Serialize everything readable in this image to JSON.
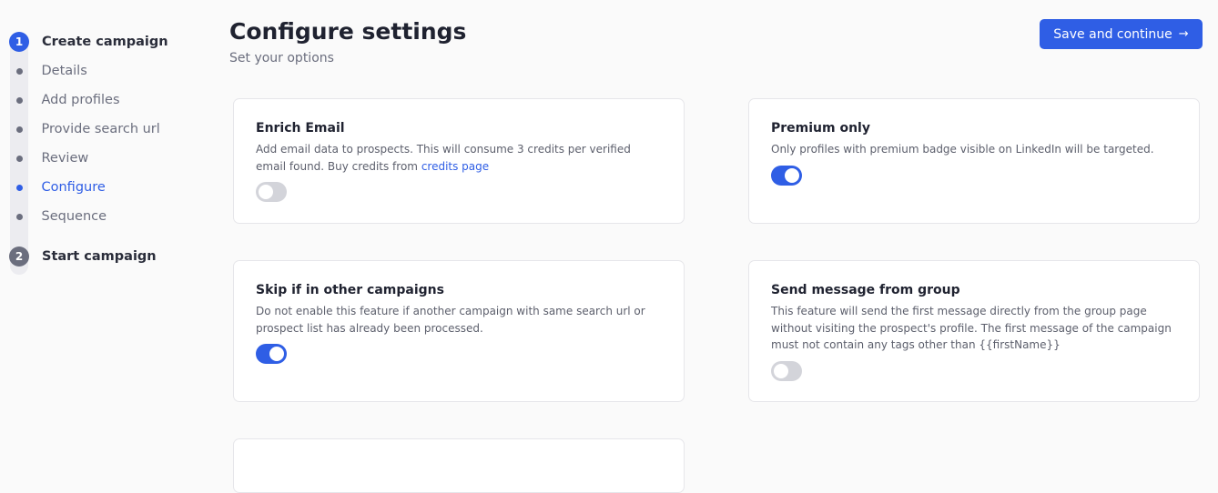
{
  "sidebar": {
    "step1": {
      "number": "1",
      "title": "Create campaign"
    },
    "items": [
      {
        "label": "Details",
        "active": false
      },
      {
        "label": "Add profiles",
        "active": false
      },
      {
        "label": "Provide search url",
        "active": false
      },
      {
        "label": "Review",
        "active": false
      },
      {
        "label": "Configure",
        "active": true
      },
      {
        "label": "Sequence",
        "active": false
      }
    ],
    "step2": {
      "number": "2",
      "title": "Start campaign"
    }
  },
  "header": {
    "title": "Configure settings",
    "subtitle": "Set your options",
    "save_label": "Save and continue",
    "save_arrow": "→"
  },
  "cards": {
    "enrich_email": {
      "title": "Enrich Email",
      "desc": "Add email data to prospects. This will consume 3 credits per verified email found. Buy credits from",
      "link": "credits page",
      "enabled": false
    },
    "premium_only": {
      "title": "Premium only",
      "desc": "Only profiles with premium badge visible on LinkedIn will be targeted.",
      "enabled": true
    },
    "skip_other": {
      "title": "Skip if in other campaigns",
      "desc": "Do not enable this feature if another campaign with same search url or prospect list has already been processed.",
      "enabled": true
    },
    "send_group": {
      "title": "Send message from group",
      "desc": "This feature will send the first message directly from the group page without visiting the prospect's profile. The first message of the campaign must not contain any tags other than {{firstName}}",
      "enabled": false
    }
  },
  "colors": {
    "accent": "#2f5ee5",
    "muted": "#6b6e7e",
    "toggle_off": "#d3d4da"
  }
}
